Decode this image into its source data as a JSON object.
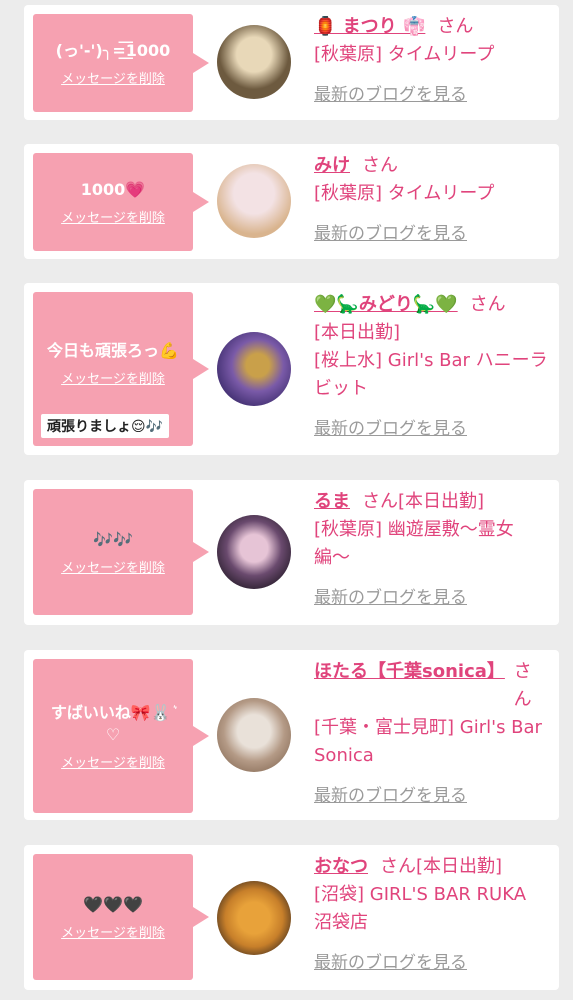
{
  "messages": [
    {
      "message": "(っ'-')╮=͟͟͞͞1000",
      "delete_label": "メッセージを削除",
      "name": "🏮 まつり 👘",
      "san": "さん",
      "shop": "[秋葉原] タイムリープ",
      "blog_label": "最新のブログを見る",
      "avatar_colors": [
        "#e8d8b8",
        "#6d5a3f"
      ]
    },
    {
      "message": "1000💗",
      "delete_label": "メッセージを削除",
      "name": "みけ",
      "san": "さん",
      "shop": "[秋葉原] タイムリープ",
      "blog_label": "最新のブログを見る",
      "avatar_colors": [
        "#f3e2e4",
        "#d9b48e"
      ]
    },
    {
      "message": "今日も頑張ろっ💪",
      "delete_label": "メッセージを削除",
      "reply": "頑張りましょ😌🎶",
      "name": "💚🦕みどり🦕💚",
      "san": "さん",
      "status": "[本日出勤]",
      "shop": "[桜上水] Girl's Bar ハニーラビット",
      "blog_label": "最新のブログを見る",
      "avatar_colors": [
        "#3a2a6a",
        "#c9a04a"
      ]
    },
    {
      "message": "🎶🎶",
      "delete_label": "メッセージを削除",
      "name": "るま",
      "san": "さん",
      "status": "[本日出勤]",
      "shop": "[秋葉原] 幽遊屋敷〜霊女編〜",
      "blog_label": "最新のブログを見る",
      "avatar_colors": [
        "#2b1f2e",
        "#e6c4d6"
      ]
    },
    {
      "message": "すばいいね🎀🐰‪‪ ͛ ♡",
      "delete_label": "メッセージを削除",
      "name": "ほたる【千葉sonica】",
      "san": "さん",
      "shop": "[千葉・富士見町] Girl's Bar Sonica",
      "blog_label": "最新のブログを見る",
      "avatar_colors": [
        "#e9e1d9",
        "#8a6f5a"
      ]
    },
    {
      "message": "🖤🖤🖤",
      "delete_label": "メッセージを削除",
      "name": "おなつ",
      "san": "さん",
      "status": "[本日出勤]",
      "shop": "[沼袋] GIRL'S BAR RUKA 沼袋店",
      "blog_label": "最新のブログを見る",
      "avatar_colors": [
        "#e8a23a",
        "#3b2a1e"
      ]
    }
  ]
}
